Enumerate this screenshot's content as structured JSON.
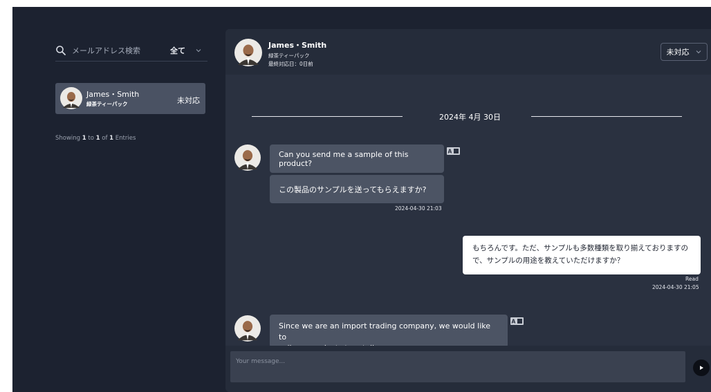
{
  "sidebar": {
    "search": {
      "placeholder": "メールアドレス検索"
    },
    "filter": {
      "value": "全て"
    },
    "contacts": [
      {
        "name": "James・Smith",
        "product": "緑茶ティーパック",
        "status": "未対応"
      }
    ],
    "showing": {
      "prefix": "Showing ",
      "from": "1",
      "to_text": " to ",
      "to": "1",
      "of_text": " of ",
      "total": "1",
      "suffix": " Entries"
    }
  },
  "chat": {
    "header": {
      "name": "James・Smith",
      "product": "緑茶ティーパック",
      "last_reply": "最終対応日：0日前",
      "status": "未対応"
    },
    "date_separator": "2024年 4月 30日",
    "messages": [
      {
        "direction": "incoming",
        "text": "Can you send me a sample of this product?",
        "translation": "この製品のサンプルを送ってもらえますか?",
        "time": "2024-04-30 21:03"
      },
      {
        "direction": "outgoing",
        "text_line1": "もちろんです。ただ、サンプルも多数種類を取り揃えておりますの",
        "text_line2": "で、サンプルの用途を教えていただけますか？",
        "read": "Read",
        "time": "2024-04-30 21:05"
      },
      {
        "direction": "incoming",
        "text_line1": "Since we are an import trading company, we would like to",
        "text_line2": "sell our products to retailers."
      }
    ],
    "composer": {
      "placeholder": "Your message..."
    }
  },
  "icons": {
    "search": "search-icon",
    "chevron": "chevron-down-icon",
    "translate": "translate-icon",
    "send": "send-icon"
  },
  "colors": {
    "background": "#1c2230",
    "panel": "#2a3140",
    "bubble_incoming": "#4c5464",
    "bubble_outgoing": "#ffffff"
  }
}
